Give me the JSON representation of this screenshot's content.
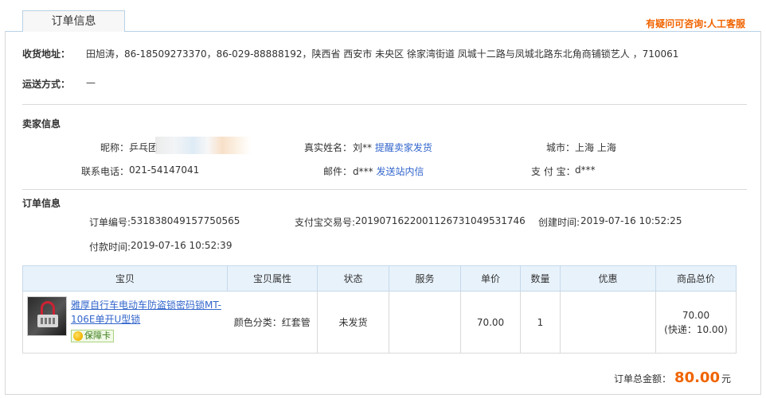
{
  "tab": {
    "title": "订单信息"
  },
  "consult": {
    "prefix": "有疑问可咨询:",
    "link": "人工客服"
  },
  "shipping": {
    "address_label": "收货地址：",
    "address_value": "田旭涛，86-18509273370，86-029-88888192，陕西省 西安市 未央区 徐家湾街道 凤城十二路与凤城北路东北角商铺锁艺人 ，710061",
    "method_label": "运送方式：",
    "method_value": "—"
  },
  "seller": {
    "section_title": "卖家信息",
    "nickname_label": "昵称：",
    "nickname_value": "乒乓团",
    "realname_label": "真实姓名：",
    "realname_value": "刘** ",
    "remind_link": "提醒卖家发货",
    "city_label": "城市：",
    "city_value": "上海 上海",
    "phone_label": "联系电话：",
    "phone_value": "021-54147041",
    "email_label": "邮件：",
    "email_value": "d*** ",
    "message_link": "发送站内信",
    "alipay_label": "支 付 宝：",
    "alipay_value": "d***"
  },
  "order": {
    "section_title": "订单信息",
    "order_no_label": "订单编号:",
    "order_no_value": "531838049157750565",
    "alipay_trade_label": "支付宝交易号:",
    "alipay_trade_value": "2019071622001126731049531746",
    "created_label": "创建时间:",
    "created_value": "2019-07-16 10:52:25",
    "paid_label": "付款时间:",
    "paid_value": "2019-07-16 10:52:39"
  },
  "items_table": {
    "headers": [
      "宝贝",
      "宝贝属性",
      "状态",
      "服务",
      "单价",
      "数量",
      "优惠",
      "商品总价"
    ],
    "rows": [
      {
        "title": "雅厚自行车电动车防盗锁密码锁MT-106E单开U型锁",
        "badge": "保障卡",
        "attribute": "颜色分类：红套管",
        "status": "未发货",
        "service": "",
        "unit_price": "70.00",
        "quantity": "1",
        "discount": "",
        "total": "70.00",
        "shipping_fee": "(快递：10.00)"
      }
    ]
  },
  "summary": {
    "label": "订单总金额：",
    "amount": "80.00",
    "unit": "元"
  },
  "colors": {
    "accent": "#f06400",
    "link": "#3366cc",
    "header_bg": "#e8f2fb",
    "border": "#c5d9ea"
  }
}
